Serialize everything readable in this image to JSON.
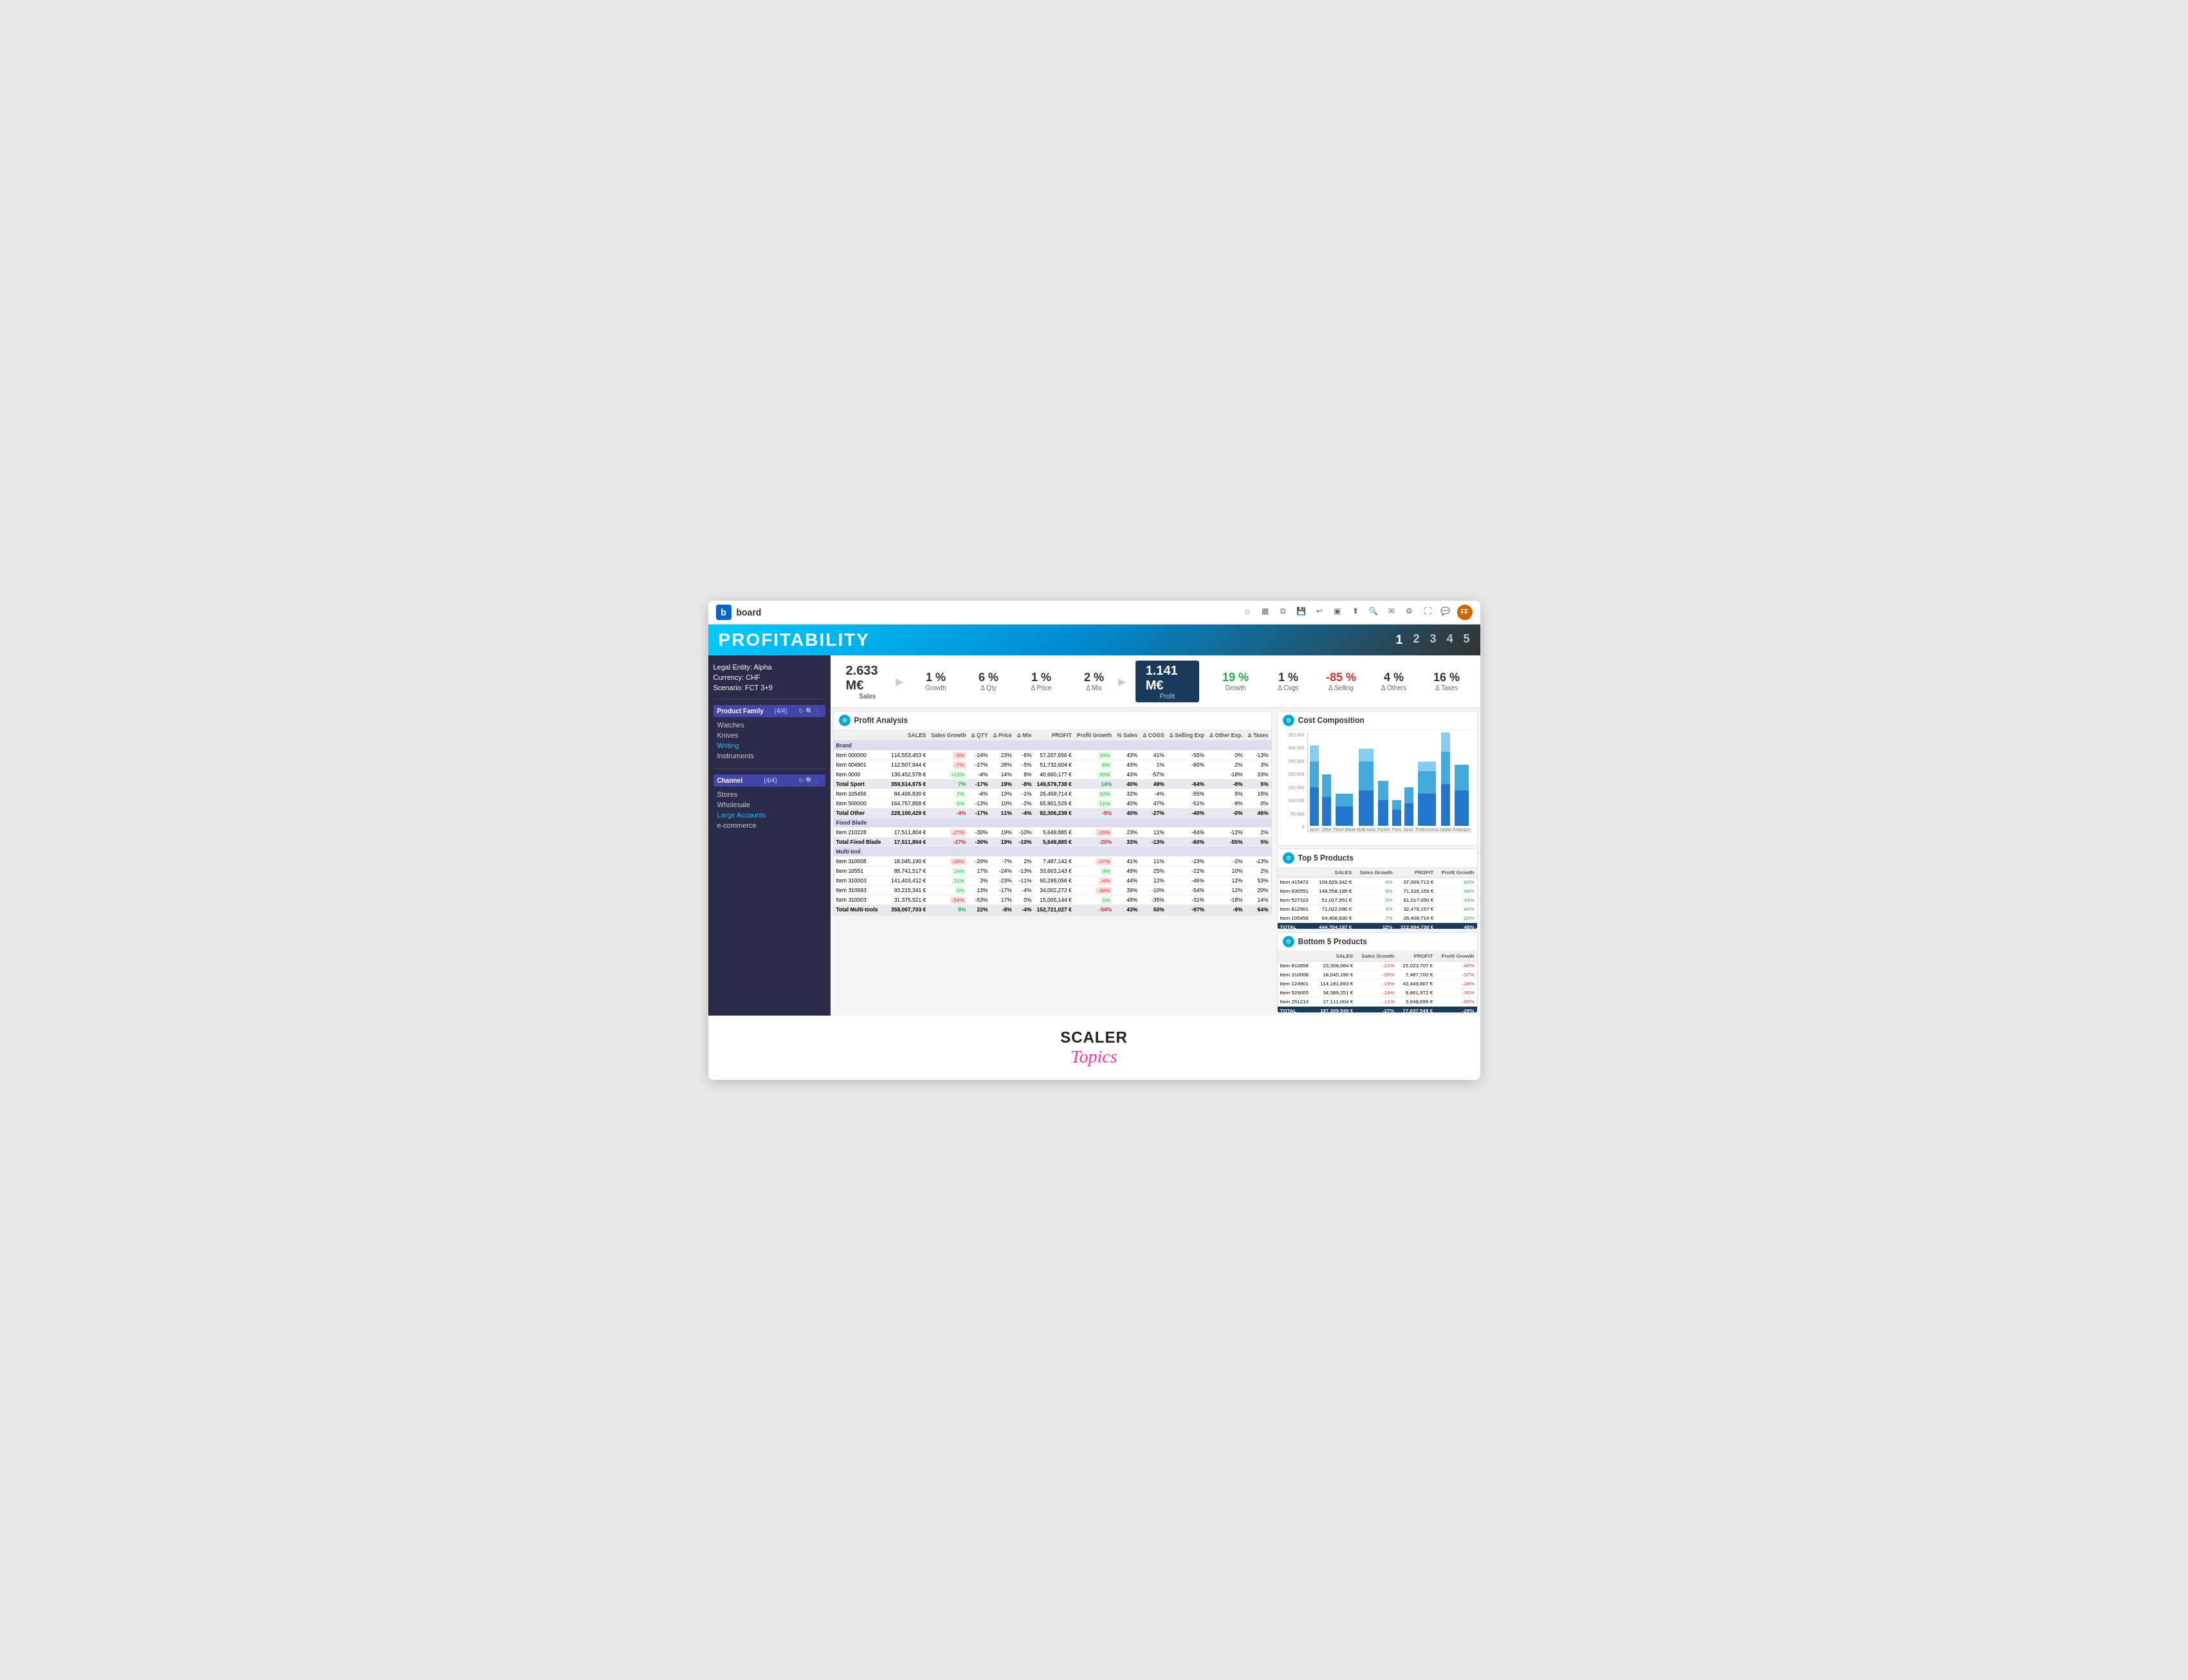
{
  "app": {
    "logo": "b",
    "name": "board"
  },
  "title": "PROFITABILITY",
  "pages": [
    "1",
    "2",
    "3",
    "4",
    "5"
  ],
  "active_page": "1",
  "sidebar": {
    "legal_entity_label": "Legal Entity: Alpha",
    "currency_label": "Currency: CHF",
    "scenario_label": "Scenario: FCT 3+9",
    "product_family": {
      "title": "Product Family",
      "count": "(4/4)",
      "items": [
        "Watches",
        "Knives",
        "Writing",
        "Instruments"
      ]
    },
    "channel": {
      "title": "Channel",
      "count": "(4/4)",
      "items": [
        "Stores",
        "Wholesale",
        "Large Accounts",
        "e-commerce"
      ]
    }
  },
  "kpis": {
    "sales_value": "2.633 M€",
    "sales_label": "Sales",
    "growth_pct": "1 %",
    "growth_label": "Growth",
    "delta_qty_pct": "6 %",
    "delta_qty_label": "Δ Qty",
    "delta_price_pct": "1 %",
    "delta_price_label": "Δ Price",
    "delta_mix_pct": "2 %",
    "delta_mix_label": "Δ Mix",
    "profit_value": "1.141 M€",
    "profit_label": "Profit",
    "growth2_pct": "19 %",
    "growth2_label": "Growth",
    "delta_cogs_pct": "1 %",
    "delta_cogs_label": "Δ Cogs",
    "delta_selling_pct": "-85 %",
    "delta_selling_label": "Δ Selling",
    "delta_others_pct": "4 %",
    "delta_others_label": "Δ Others",
    "delta_taxes_pct": "16 %",
    "delta_taxes_label": "Δ Taxes"
  },
  "profit_analysis": {
    "title": "Profit Analysis",
    "columns": [
      "SALES",
      "Sales Growth",
      "Δ QTY",
      "Δ Price",
      "Δ Mix",
      "PROFIT",
      "Profit Growth",
      "% Sales",
      "Δ COGS",
      "Δ Selling Exp",
      "Δ Other Expenses",
      "Δ Taxes"
    ],
    "rows": [
      {
        "name": "Brand",
        "type": "group",
        "sales": "",
        "sales_growth": "",
        "delta_qty": "",
        "delta_price": "",
        "delta_mix": "",
        "profit": "",
        "profit_growth": "",
        "pct_sales": "",
        "delta_cogs": "",
        "delta_selling": "",
        "delta_other": "",
        "delta_taxes": ""
      },
      {
        "name": "Item 000000",
        "type": "item",
        "sales": "116,553,453 €",
        "sg": "-5%",
        "dq": "-24%",
        "dp": "23%",
        "dm": "-6%",
        "profit": "57,207,656 €",
        "pg": "19%",
        "ps": "43%",
        "dc": "41%",
        "ds": "-55%",
        "dother": "0%",
        "dtax": "-13%"
      },
      {
        "name": "Item 004901",
        "type": "item",
        "sales": "112,507,944 €",
        "sg": "-7%",
        "dq": "-27%",
        "dp": "28%",
        "dm": "-5%",
        "profit": "51,732,604 €",
        "pg": "8%",
        "ps": "43%",
        "dc": "1%",
        "ds": "-60%",
        "dother": "2%",
        "dtax": "3%"
      },
      {
        "name": "Item 0000",
        "type": "item",
        "sales": "130,452,578 €",
        "sg": "+12%",
        "dq": "-4%",
        "dp": "14%",
        "dm": "8%",
        "profit": "40,660,177 €",
        "pg": "33%",
        "ps": "43%",
        "dc": "-57%",
        "dother": "-18%",
        "dtax": "33%"
      },
      {
        "name": "Total Sport",
        "type": "total",
        "sales": "359,514,975 €",
        "sg": "7%",
        "dq": "-17%",
        "dp": "19%",
        "dm": "-8%",
        "profit": "149,579,738 €",
        "pg": "14%",
        "ps": "40%",
        "dc": "49%",
        "ds": "-64%",
        "dother": "-8%",
        "dtax": "5%"
      },
      {
        "name": "Item 105456",
        "type": "item",
        "sales": "84,406,830 €",
        "sg": "7%",
        "dq": "-4%",
        "dp": "13%",
        "dm": "-1%",
        "profit": "26,459,714 €",
        "pg": "10%",
        "ps": "32%",
        "dc": "-4%",
        "ds": "-55%",
        "dother": "5%",
        "dtax": "15%"
      },
      {
        "name": "Item 500000",
        "type": "item",
        "sales": "164,757,858 €",
        "sg": "0%",
        "dq": "-13%",
        "dp": "10%",
        "dm": "-2%",
        "profit": "65,901,526 €",
        "pg": "11%",
        "ps": "40%",
        "dc": "47%",
        "ds": "-51%",
        "dother": "-9%",
        "dtax": "0%"
      },
      {
        "name": "Total Other",
        "type": "total",
        "sales": "228,100,429 €",
        "sg": "-4%",
        "dq": "-17%",
        "dp": "11%",
        "dm": "-4%",
        "profit": "92,306,238 €",
        "pg": "-8%",
        "ps": "40%",
        "dc": "-27%",
        "ds": "-40%",
        "dother": "-0%",
        "dtax": "46%"
      },
      {
        "name": "Fixed Blade",
        "type": "group"
      },
      {
        "name": "Item 210228",
        "type": "item",
        "sales": "17,511,804 €",
        "sg": "-27%",
        "dq": "-30%",
        "dp": "19%",
        "dm": "-10%",
        "profit": "5,649,885 €",
        "pg": "-20%",
        "ps": "23%",
        "dc": "11%",
        "ds": "-84%",
        "dother": "-12%",
        "dtax": "2%"
      },
      {
        "name": "Total Fixed Blade",
        "type": "total",
        "sales": "17,511,804 €",
        "sg": "-27%",
        "dq": "-30%",
        "dp": "19%",
        "dm": "-10%",
        "profit": "5,649,885 €",
        "pg": "-20%",
        "ps": "33%",
        "dc": "-13%",
        "ds": "-60%",
        "dother": "-55%",
        "dtax": "5%"
      },
      {
        "name": "Multi-tool",
        "type": "group"
      },
      {
        "name": "Item 310008",
        "type": "item",
        "sales": "18,045,190 €",
        "sg": "-20%",
        "dq": "-20%",
        "dp": "-7%",
        "dm": "2%",
        "profit": "7,487,142 €",
        "pg": "-27%",
        "ps": "41%",
        "dc": "11%",
        "ds": "-23%",
        "dother": "-2%",
        "dtax": "-13%"
      },
      {
        "name": "Item 10551",
        "type": "item",
        "sales": "88,741,517 €",
        "sg": "14%",
        "dq": "17%",
        "dp": "-24%",
        "dm": "-13%",
        "profit": "33,603,143 €",
        "pg": "3%",
        "ps": "49%",
        "dc": "25%",
        "ds": "-22%",
        "dother": "10%",
        "dtax": "2%"
      },
      {
        "name": "Item 310003",
        "type": "item",
        "sales": "141,403,412 €",
        "sg": "21%",
        "dq": "3%",
        "dp": "-23%",
        "dm": "-11%",
        "profit": "60,299,056 €",
        "pg": "-4%",
        "ps": "44%",
        "dc": "12%",
        "ds": "-46%",
        "dother": "12%",
        "dtax": "53%"
      },
      {
        "name": "Item 310993",
        "type": "item",
        "sales": "93,215,341 €",
        "sg": "0%",
        "dq": "13%",
        "dp": "-17%",
        "dm": "-4%",
        "profit": "34,002,272 €",
        "pg": "-38%",
        "ps": "39%",
        "dc": "-10%",
        "ds": "-54%",
        "dother": "12%",
        "dtax": "20%"
      },
      {
        "name": "Item 310003",
        "type": "item",
        "sales": "31,375,521 €",
        "sg": "-54%",
        "dq": "-53%",
        "dp": "17%",
        "dm": "0%",
        "profit": "15,005,144 €",
        "pg": "1%",
        "ps": "48%",
        "dc": "-35%",
        "ds": "-31%",
        "dother": "-18%",
        "dtax": "14%"
      },
      {
        "name": "Total Multi-tools",
        "type": "total",
        "sales": "358,007,703 €",
        "sg": "8%",
        "dq": "22%",
        "dp": "-8%",
        "dm": "-4%",
        "profit": "152,721,027 €",
        "pg": "-54%",
        "ps": "43%",
        "dc": "50%",
        "ds": "-97%",
        "dother": "-9%",
        "dtax": "64%"
      }
    ]
  },
  "cost_composition": {
    "title": "Cost Composition",
    "y_axis": [
      "350,000",
      "300,000",
      "250,000",
      "200,000",
      "150,000",
      "100,000",
      "50,000",
      "0"
    ],
    "bars": [
      {
        "label": "Sport",
        "segments": [
          {
            "color": "#2277cc",
            "height": 60
          },
          {
            "color": "#44aadd",
            "height": 40
          },
          {
            "color": "#88ccee",
            "height": 25
          }
        ]
      },
      {
        "label": "Other",
        "segments": [
          {
            "color": "#2277cc",
            "height": 45
          },
          {
            "color": "#44aadd",
            "height": 35
          }
        ]
      },
      {
        "label": "Fixed Blade",
        "segments": [
          {
            "color": "#2277cc",
            "height": 30
          },
          {
            "color": "#44aadd",
            "height": 20
          }
        ]
      },
      {
        "label": "Multi-tools",
        "segments": [
          {
            "color": "#2277cc",
            "height": 55
          },
          {
            "color": "#44aadd",
            "height": 45
          },
          {
            "color": "#88ccee",
            "height": 20
          }
        ]
      },
      {
        "label": "Pocket",
        "segments": [
          {
            "color": "#2277cc",
            "height": 40
          },
          {
            "color": "#44aadd",
            "height": 30
          }
        ]
      },
      {
        "label": "Pens",
        "segments": [
          {
            "color": "#2277cc",
            "height": 25
          },
          {
            "color": "#44aadd",
            "height": 15
          }
        ]
      },
      {
        "label": "Basic",
        "segments": [
          {
            "color": "#2277cc",
            "height": 35
          },
          {
            "color": "#44aadd",
            "height": 25
          }
        ]
      },
      {
        "label": "Professional",
        "segments": [
          {
            "color": "#2277cc",
            "height": 50
          },
          {
            "color": "#44aadd",
            "height": 35
          },
          {
            "color": "#88ccee",
            "height": 15
          }
        ]
      },
      {
        "label": "Digital",
        "segments": [
          {
            "color": "#2277cc",
            "height": 65
          },
          {
            "color": "#44aadd",
            "height": 50
          },
          {
            "color": "#88ccee",
            "height": 30
          }
        ]
      },
      {
        "label": "Analogue",
        "segments": [
          {
            "color": "#2277cc",
            "height": 55
          },
          {
            "color": "#44aadd",
            "height": 40
          }
        ]
      }
    ]
  },
  "top5": {
    "title": "Top 5 Products",
    "columns": [
      "",
      "SALES",
      "Sales Growth",
      "PROFIT",
      "Profit Growth"
    ],
    "rows": [
      {
        "name": "Item 415472",
        "sales": "109,629,342 €",
        "sg": "8%",
        "profit": "37,009,713 €",
        "pg": "82%"
      },
      {
        "name": "Item 830551",
        "sales": "148,558,185 €",
        "sg": "9%",
        "profit": "71,316,169 €",
        "pg": "48%"
      },
      {
        "name": "Item 527103",
        "sales": "51,027,951 €",
        "sg": "0%",
        "profit": "61,017,050 €",
        "pg": "49%"
      },
      {
        "name": "Item 812901",
        "sales": "71,022,090 €",
        "sg": "3%",
        "profit": "32,479,157 €",
        "pg": "44%"
      },
      {
        "name": "Item 105456",
        "sales": "64,408,830 €",
        "sg": "7%",
        "profit": "26,408,714 €",
        "pg": "32%"
      },
      {
        "name": "TOTAL",
        "sales": "444,704,187 €",
        "sg": "12%",
        "profit": "212,894,738 €",
        "pg": "48%",
        "is_total": true
      }
    ]
  },
  "bottom5": {
    "title": "Bottom 5 Products",
    "columns": [
      "",
      "SALES",
      "Sales Growth",
      "PROFIT",
      "Profit Growth"
    ],
    "rows": [
      {
        "name": "Item 810856",
        "sales": "23,308,064 €",
        "sg": "-22%",
        "profit": "15,023,707 €",
        "pg": "-40%"
      },
      {
        "name": "Item 310008",
        "sales": "18,045,190 €",
        "sg": "-29%",
        "profit": "7,487,702 €",
        "pg": "-37%"
      },
      {
        "name": "Item 124901",
        "sales": "114,181,893 €",
        "sg": "-19%",
        "profit": "43,349,807 €",
        "pg": "-28%"
      },
      {
        "name": "Item 529005",
        "sales": "34,389,251 €",
        "sg": "-19%",
        "profit": "8,861,972 €",
        "pg": "-30%"
      },
      {
        "name": "Item 251210",
        "sales": "17,111,004 €",
        "sg": "-11%",
        "profit": "3,648,895 €",
        "pg": "-30%"
      },
      {
        "name": "TOTAL",
        "sales": "197,309,549 €",
        "sg": "-27%",
        "profit": "77,037,549 €",
        "pg": "-29%",
        "is_total": true
      }
    ]
  },
  "footer": {
    "brand": "SCALER",
    "sub": "Topics"
  }
}
